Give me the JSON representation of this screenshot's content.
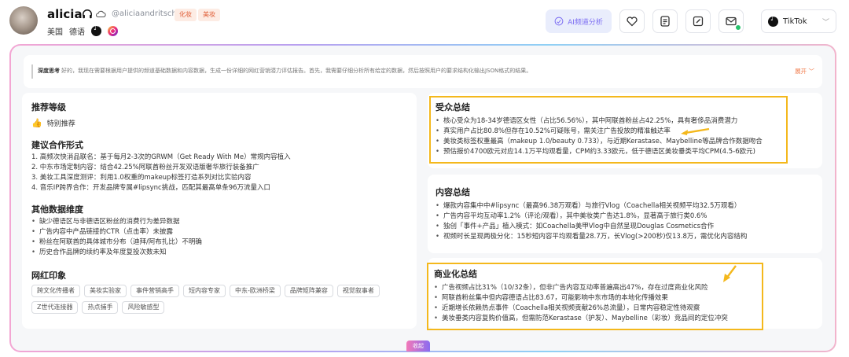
{
  "profile": {
    "name": "alicia",
    "handle": "@aliciaandritschke",
    "tags": [
      "化妆",
      "美妆"
    ],
    "country": "美国",
    "language": "德语"
  },
  "toolbar": {
    "ai_label": "AI频道分析",
    "platform": "TikTok"
  },
  "thinking": {
    "label": "深度思考",
    "text": "好的，我现在需要根据用户提供的频道基础数据和内容数据，生成一份详细的网红营销潜力评估报告。首先，我需要仔细分析所有给定的数据，然后按照用户的要求结构化输出JSON格式的结果。",
    "expand": "展开"
  },
  "left": {
    "rating_title": "推荐等级",
    "rating_value": "特别推荐",
    "coop_title": "建议合作形式",
    "coop_items": [
      "1. 高频次快消品联名：基于每月2-3次的GRWM（Get Ready With Me）常规内容植入",
      "2. 中东市场定制内容：结合42.25%阿联酋粉丝开发双语版奢华旅行装备推广",
      "3. 美妆工具深度测评：利用1.0权重的makeup标签打造系列对比实验内容",
      "4. 音乐IP跨界合作：开发品牌专属#lipsync挑战，匹配其最高单条96万流量入口"
    ],
    "other_title": "其他数据维度",
    "other_items": [
      "缺少德语区与非德语区粉丝的消费行为差异数据",
      "广告内容中产品链接的CTR（点击率）未披露",
      "粉丝在阿联酋的具体城市分布（迪拜/阿布扎比）不明确",
      "历史合作品牌的续约率及年度复投次数未知"
    ],
    "impression_title": "网红印象",
    "impression_tags": [
      "跨文化传播者",
      "美妆实验家",
      "事件营销高手",
      "短内容专家",
      "中东-欧洲桥梁",
      "品牌矩阵兼容",
      "视觉叙事者",
      "Z世代连接器",
      "热点捕手",
      "风险敏感型"
    ]
  },
  "audience": {
    "title": "受众总结",
    "items": [
      "核心受众为18-34岁德语区女性（占比56.56%），其中阿联酋粉丝占42.25%，具有奢侈品消费潜力",
      "真实用户占比80.8%但存在10.52%可疑账号，需关注广告投放的精准触达率",
      "美妆类标签权重最高（makeup 1.0/beauty 0.733），与近期Kerastase、Maybelline等品牌合作数据吻合",
      "预估报价4700欧元对应14.1万平均观看量，CPM约3.33欧元，低于德语区美妆垂类平均CPM(4.5-6欧元)"
    ]
  },
  "content": {
    "title": "内容总结",
    "items": [
      "爆款内容集中中#lipsync（最高96.38万观看）与旅行Vlog（Coachella相关视频平均32.5万观看）",
      "广告内容平均互动率1.2%（评论/观看），其中美妆类广告达1.8%，显著高于旅行类0.6%",
      "独创「事件+产品」植入模式：如Coachella美甲Vlog中自然呈现Douglas Cosmetics合作",
      "视频时长呈现两极分化：15秒短内容平均观看量28.7万，长Vlog(>200秒)仅13.8万，需优化内容结构"
    ]
  },
  "business": {
    "title": "商业化总结",
    "items": [
      "广告视频占比31%（10/32条），但非广告内容互动率普遍高出47%，存在过度商业化风险",
      "阿联酋粉丝集中但内容德语占比83.67，可能影响中东市场的本地化传播效果",
      "近期增长依赖热点事件（Coachella相关视频贡献26%总流量），日常内容稳定性待观察",
      "美妆垂类内容复购价值高，但需防范Kerastase（护发）、Maybelline（彩妆）竞品间的定位冲突"
    ]
  },
  "collapse_label": "收起",
  "colors": {
    "highlight": "#f4b81c",
    "accent": "#f06a28",
    "ai": "#7b6cf2"
  }
}
